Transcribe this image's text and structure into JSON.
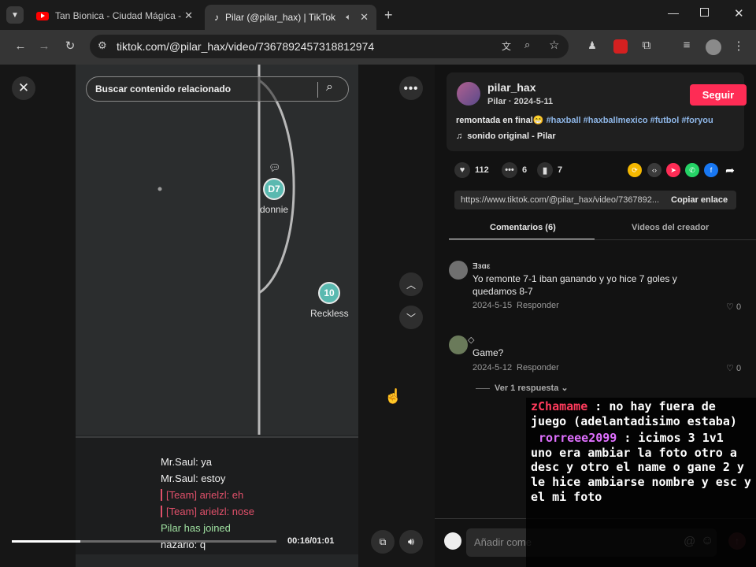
{
  "browser": {
    "tabs": [
      {
        "title": "Tan Bionica - Ciudad Mágica - Y",
        "icon": "youtube-icon",
        "active": false
      },
      {
        "title": "Pilar (@pilar_hax) | TikTok",
        "icon": "tiktok-icon",
        "active": true
      }
    ],
    "url": "tiktok.com/@pilar_hax/video/7367892457318812974"
  },
  "video": {
    "search_placeholder": "Buscar contenido relacionado",
    "players": [
      {
        "number": "D7",
        "name": "donnie"
      },
      {
        "number": "10",
        "name": "Reckless"
      }
    ],
    "chat": [
      {
        "text": "Mr.Saul: ya",
        "kind": "normal"
      },
      {
        "text": "Mr.Saul: estoy",
        "kind": "normal"
      },
      {
        "text": "[Team] arielzl: eh",
        "kind": "team"
      },
      {
        "text": "[Team] arielzl: nose",
        "kind": "team"
      },
      {
        "text": "Pilar has joined",
        "kind": "join"
      },
      {
        "text": "nazario: q",
        "kind": "normal"
      }
    ],
    "time": "00:16/01:01",
    "progress": 0.26
  },
  "post": {
    "username": "pilar_hax",
    "subline": "Pilar · 2024-5-11",
    "follow_label": "Seguir",
    "caption": "remontada en final😁",
    "hashtags": "#haxball #haxballmexico #futbol #foryou",
    "sound": "sonido original - Pilar",
    "likes": "112",
    "comments": "6",
    "saves": "7",
    "link": "https://www.tiktok.com/@pilar_hax/video/7367892...",
    "copy_label": "Copiar enlace"
  },
  "tabs": {
    "comments_label": "Comentarios (6)",
    "creator_label": "Videos del creador"
  },
  "comments": [
    {
      "user": "Ǝзɑε",
      "text1": "Yo remonte 7-1 iban ganando y yo hice 7 goles y",
      "text2": "quedamos 8-7",
      "date": "2024-5-15",
      "reply": "Responder",
      "likes": "0"
    },
    {
      "user": "◇",
      "text1": "Game?",
      "text2": "",
      "date": "2024-5-12",
      "reply": "Responder",
      "likes": "0"
    }
  ],
  "view_replies": "Ver 1 respuesta",
  "add_comment_placeholder": "Añadir come",
  "overlay_chat": {
    "user1": "zChamame",
    "msg1": ": no hay fuera de juego (adelantadisimo estaba)",
    "user2": "rorreee2099",
    "msg2": ": icimos 3 1v1 uno era ambiar la foto otro a desc y otro el name o gane 2 y le hice ambiarse nombre y esc y el mi foto"
  }
}
